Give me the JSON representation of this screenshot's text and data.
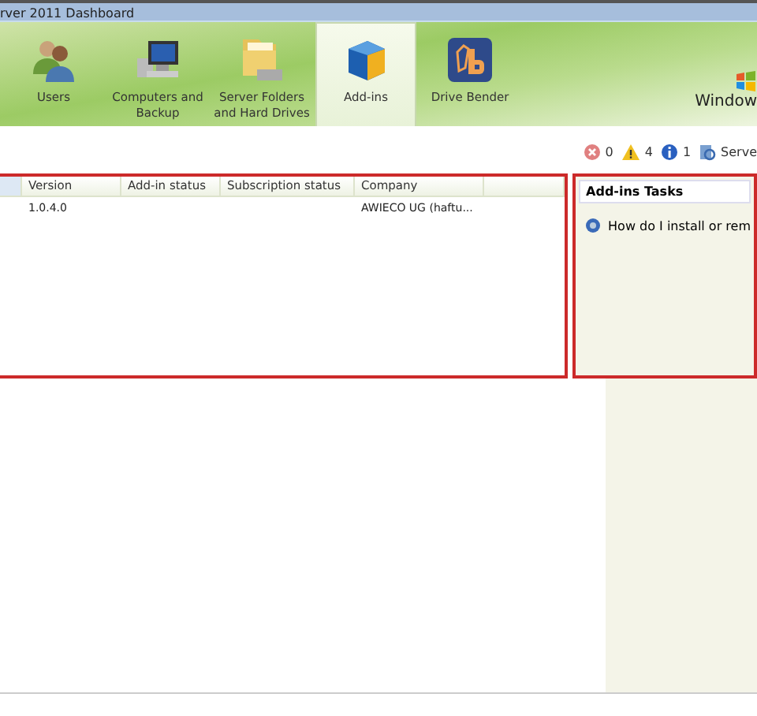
{
  "window": {
    "title": "rver 2011 Dashboard"
  },
  "nav": [
    {
      "label": "Users",
      "selected": false
    },
    {
      "label": "Computers and Backup",
      "selected": false
    },
    {
      "label": "Server Folders and Hard Drives",
      "selected": false
    },
    {
      "label": "Add-ins",
      "selected": true
    },
    {
      "label": "Drive Bender",
      "selected": false
    }
  ],
  "brand": "Window",
  "alerts": [
    {
      "kind": "error",
      "count": "0"
    },
    {
      "kind": "warning",
      "count": "4"
    },
    {
      "kind": "info",
      "count": "1"
    }
  ],
  "server_link": "Serve",
  "table": {
    "columns": [
      "",
      "Version",
      "Add-in status",
      "Subscription status",
      "Company",
      ""
    ],
    "rows": [
      [
        "",
        "1.0.4.0",
        "",
        "",
        "AWIECO UG (haftu...",
        ""
      ]
    ]
  },
  "tasks": {
    "title": "Add-ins Tasks",
    "items": [
      "How do I install or rem"
    ]
  }
}
